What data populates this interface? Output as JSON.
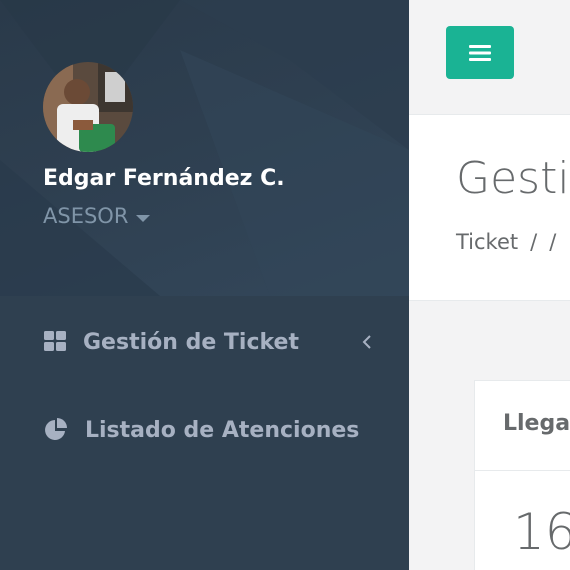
{
  "profile": {
    "name": "Edgar Fernández C.",
    "role": "ASESOR"
  },
  "nav": {
    "items": [
      {
        "label": "Gestión de Ticket",
        "icon": "grid-icon",
        "has_submenu": true
      },
      {
        "label": "Listado de Atenciones",
        "icon": "pie-chart-icon",
        "has_submenu": false
      }
    ]
  },
  "topbar": {
    "menu_icon": "hamburger-icon",
    "accent_color": "#1ab394"
  },
  "heading": {
    "title": "Gestio",
    "breadcrumb": [
      "Ticket",
      "/",
      "/"
    ]
  },
  "widget": {
    "title": "Llega",
    "value": "16"
  },
  "colors": {
    "sidebar_bg": "#2f4050",
    "nav_text": "#a7b1c2",
    "content_bg": "#f3f3f4"
  }
}
